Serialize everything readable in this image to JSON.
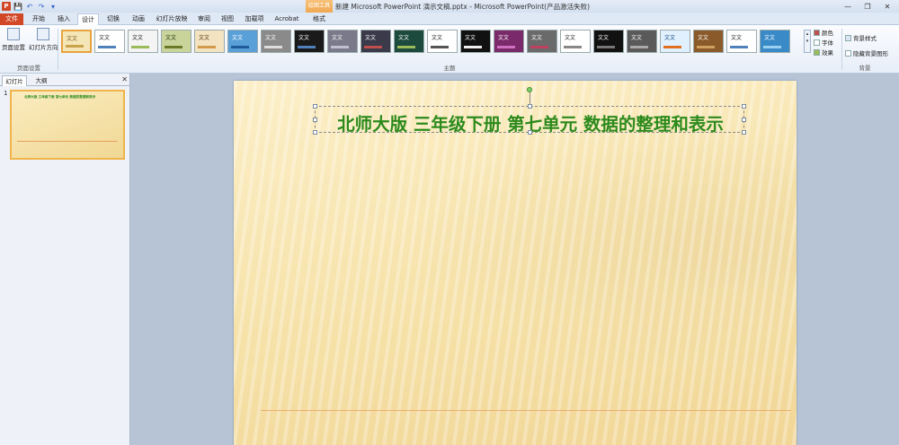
{
  "window": {
    "contextual_tab_header": "绘图工具",
    "title": "新建 Microsoft PowerPoint 演示文稿.pptx  -  Microsoft PowerPoint(产品激活失败)"
  },
  "quick_access": {
    "app_icon": "P",
    "save": "💾",
    "undo": "↶",
    "redo": "↷",
    "customize": "▾"
  },
  "window_controls": {
    "minimize": "—",
    "restore": "❐",
    "close": "✕"
  },
  "tabs": [
    "文件",
    "开始",
    "插入",
    "设计",
    "切换",
    "动画",
    "幻灯片放映",
    "审阅",
    "视图",
    "加载项",
    "Acrobat",
    "格式"
  ],
  "active_tab": "设计",
  "ribbon": {
    "page_setup": {
      "button1": "页面设置",
      "button2": "幻灯片方向",
      "group_label": "页面设置"
    },
    "themes": {
      "group_label": "主题",
      "items": [
        {
          "text": "文文",
          "bg": "#f5e6b8",
          "fg": "#7a5a1a",
          "bar": "#c9a24a"
        },
        {
          "text": "文文",
          "bg": "#ffffff",
          "fg": "#222222",
          "bar": "#4f81bd"
        },
        {
          "text": "文文",
          "bg": "#f4f4f4",
          "fg": "#222222",
          "bar": "#9bbb59"
        },
        {
          "text": "文文",
          "bg": "#c9d49a",
          "fg": "#223311",
          "bar": "#6a7a2a"
        },
        {
          "text": "文文",
          "bg": "#f3e3c0",
          "fg": "#553311",
          "bar": "#d09a4a"
        },
        {
          "text": "文文",
          "bg": "#5aa0d8",
          "fg": "#ffffff",
          "bar": "#1f5a9a"
        },
        {
          "text": "文文",
          "bg": "#8a8a8a",
          "fg": "#ffffff",
          "bar": "#dddddd"
        },
        {
          "text": "文文",
          "bg": "#1a1a1a",
          "fg": "#ffffff",
          "bar": "#4f81bd"
        },
        {
          "text": "文文",
          "bg": "#7a7a8a",
          "fg": "#ffffff",
          "bar": "#c0c0d0"
        },
        {
          "text": "文文",
          "bg": "#3a3a4a",
          "fg": "#ffffff",
          "bar": "#c0504d"
        },
        {
          "text": "文文",
          "bg": "#1c4a3c",
          "fg": "#ffffff",
          "bar": "#9bbb59"
        },
        {
          "text": "文文",
          "bg": "#ffffff",
          "fg": "#222222",
          "bar": "#555555"
        },
        {
          "text": "文文",
          "bg": "#111111",
          "fg": "#ffffff",
          "bar": "#eeeeee"
        },
        {
          "text": "文文",
          "bg": "#7a2a6a",
          "fg": "#ffffff",
          "bar": "#d070c0"
        },
        {
          "text": "文文",
          "bg": "#6a6a6a",
          "fg": "#ffffff",
          "bar": "#c04060"
        },
        {
          "text": "文文",
          "bg": "#ffffff",
          "fg": "#222222",
          "bar": "#888888"
        },
        {
          "text": "文文",
          "bg": "#111111",
          "fg": "#ffffff",
          "bar": "#777777"
        },
        {
          "text": "文文",
          "bg": "#5a5a5a",
          "fg": "#ffffff",
          "bar": "#aaaaaa"
        },
        {
          "text": "文文",
          "bg": "#e0f0ff",
          "fg": "#1a4a7a",
          "bar": "#e07020"
        },
        {
          "text": "文文",
          "bg": "#8a5a2a",
          "fg": "#ffffff",
          "bar": "#d0a060"
        },
        {
          "text": "文文",
          "bg": "#ffffff",
          "fg": "#222222",
          "bar": "#4f81bd"
        },
        {
          "text": "文文",
          "bg": "#3a8ac8",
          "fg": "#ffffff",
          "bar": "#9ad0f0"
        }
      ]
    },
    "theme_options": {
      "colors": "颜色",
      "fonts": "字体",
      "effects": "效果"
    },
    "background": {
      "styles": "背景样式",
      "hide_graphics": "隐藏背景图形",
      "group_label": "背景"
    }
  },
  "left_panel": {
    "tab_slides": "幻灯片",
    "tab_outline": "大纲",
    "close": "✕",
    "slide_number": "1",
    "thumb_title": "北师大版 三年级下册 第七单元 数据的整理和表示"
  },
  "slide": {
    "title": "北师大版  三年级下册  第七单元  数据的整理和表示"
  }
}
